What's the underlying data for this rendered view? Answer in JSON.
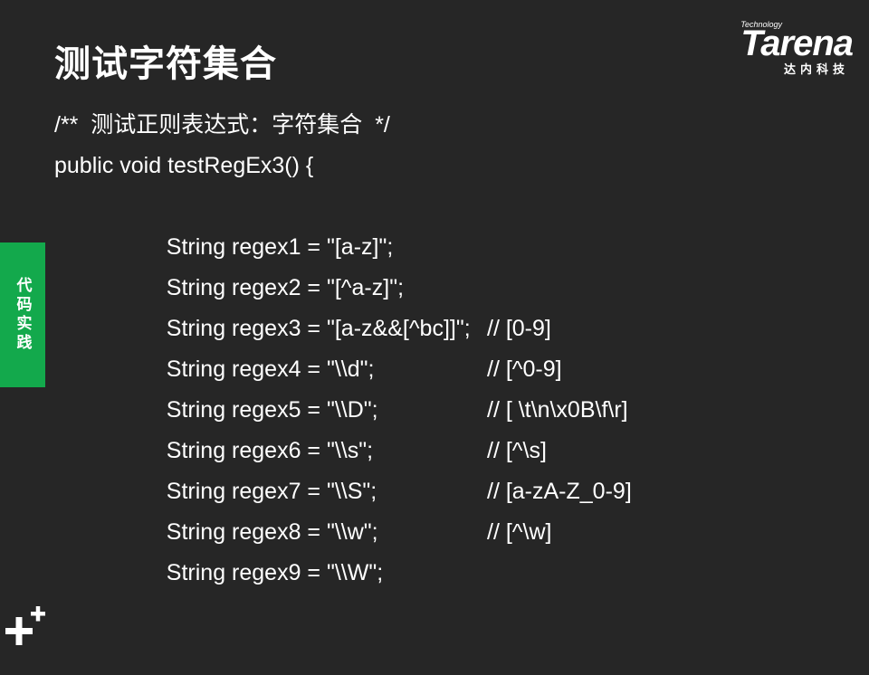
{
  "title": "测试字符集合",
  "logo": {
    "tech": "Technology",
    "brand": "Tarena",
    "cn": "达内科技"
  },
  "side_tab": "代码实践",
  "code": {
    "comment_line": "/**  测试正则表达式：字符集合  */",
    "signature": "public void testRegEx3() {",
    "lines": [
      {
        "stmt": "String regex1 = \"[a-z]\";",
        "cmt": ""
      },
      {
        "stmt": "String regex2 = \"[^a-z]\";",
        "cmt": ""
      },
      {
        "stmt": "String regex3 = \"[a-z&&[^bc]]\";",
        "cmt": ""
      },
      {
        "stmt": "String regex4 = \"\\\\d\";",
        "cmt": "// [0-9]"
      },
      {
        "stmt": "String regex5 = \"\\\\D\";",
        "cmt": "// [^0-9]"
      },
      {
        "stmt": "String regex6 = \"\\\\s\";",
        "cmt": "// [ \\t\\n\\x0B\\f\\r]"
      },
      {
        "stmt": "String regex7 = \"\\\\S\";",
        "cmt": "// [^\\s]"
      },
      {
        "stmt": "String regex8 = \"\\\\w\";",
        "cmt": "// [a-zA-Z_0-9]"
      },
      {
        "stmt": "String regex9 = \"\\\\W\";",
        "cmt": "// [^\\w]"
      }
    ]
  },
  "icons": {
    "corner": "plus-plus-icon"
  }
}
